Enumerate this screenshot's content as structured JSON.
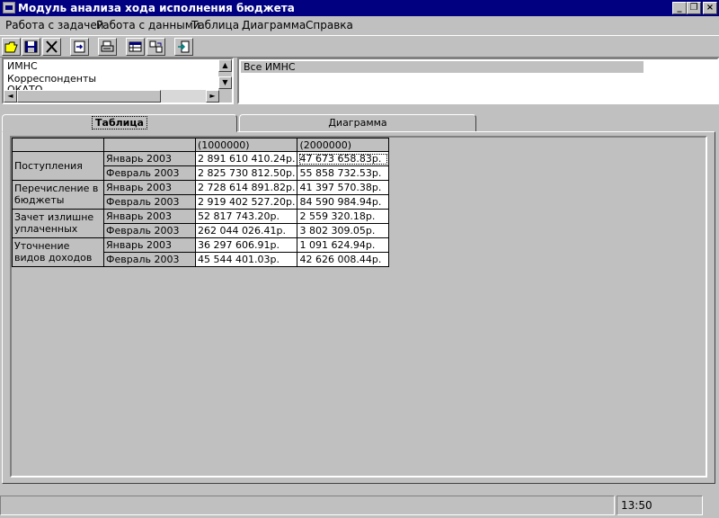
{
  "window": {
    "title": "Модуль анализа хода исполнения бюджета",
    "controls": [
      "_",
      "❐",
      "×"
    ]
  },
  "menu": [
    "Работа с задачей",
    "Работа с данными",
    "Таблица",
    "Диаграмма",
    "Справка"
  ],
  "toolbar": [
    "open-folder-icon",
    "save-icon",
    "delete-icon",
    "import-icon",
    "print-icon",
    "table-icon",
    "swap-icon",
    "exit-icon"
  ],
  "left_list": {
    "items": [
      "ИМНС",
      "Корреспонденты",
      "ОКАТО"
    ],
    "scroll_up": "▲",
    "scroll_down": "▼",
    "scroll_left": "◄",
    "scroll_right": "►"
  },
  "right_list": {
    "selected": "Все ИМНС"
  },
  "tabs": {
    "table": "Таблица",
    "chart": "Диаграмма"
  },
  "grid": {
    "columns": [
      "(1000000)",
      "(2000000)"
    ],
    "groups": [
      {
        "label": "Поступления",
        "rows": [
          {
            "period": "Январь 2003",
            "v1": "2 891 610 410.24р.",
            "v2": "47 673 658.83р."
          },
          {
            "period": "Февраль 2003",
            "v1": "2 825 730 812.50р.",
            "v2": "55 858 732.53р."
          }
        ]
      },
      {
        "label": "Перечисление в бюджеты разных",
        "rows": [
          {
            "period": "Январь 2003",
            "v1": "2 728 614 891.82р.",
            "v2": "41 397 570.38р."
          },
          {
            "period": "Февраль 2003",
            "v1": "2 919 402 527.20р.",
            "v2": "84 590 984.94р."
          }
        ]
      },
      {
        "label": "Зачет излишне уплаченных сумм",
        "rows": [
          {
            "period": "Январь 2003",
            "v1": "52 817 743.20р.",
            "v2": "2 559 320.18р."
          },
          {
            "period": "Февраль 2003",
            "v1": "262 044 026.41р.",
            "v2": "3 802 309.05р."
          }
        ]
      },
      {
        "label": "Уточнение видов доходов",
        "rows": [
          {
            "period": "Январь 2003",
            "v1": "36 297 606.91р.",
            "v2": "1 091 624.94р."
          },
          {
            "period": "Февраль 2003",
            "v1": "45 544 401.03р.",
            "v2": "42 626 008.44р."
          }
        ]
      }
    ]
  },
  "status": {
    "message": "",
    "time": "13:50"
  },
  "colors": {
    "titlebar": "#000080",
    "face": "#c0c0c0",
    "window": "#ffffff"
  }
}
